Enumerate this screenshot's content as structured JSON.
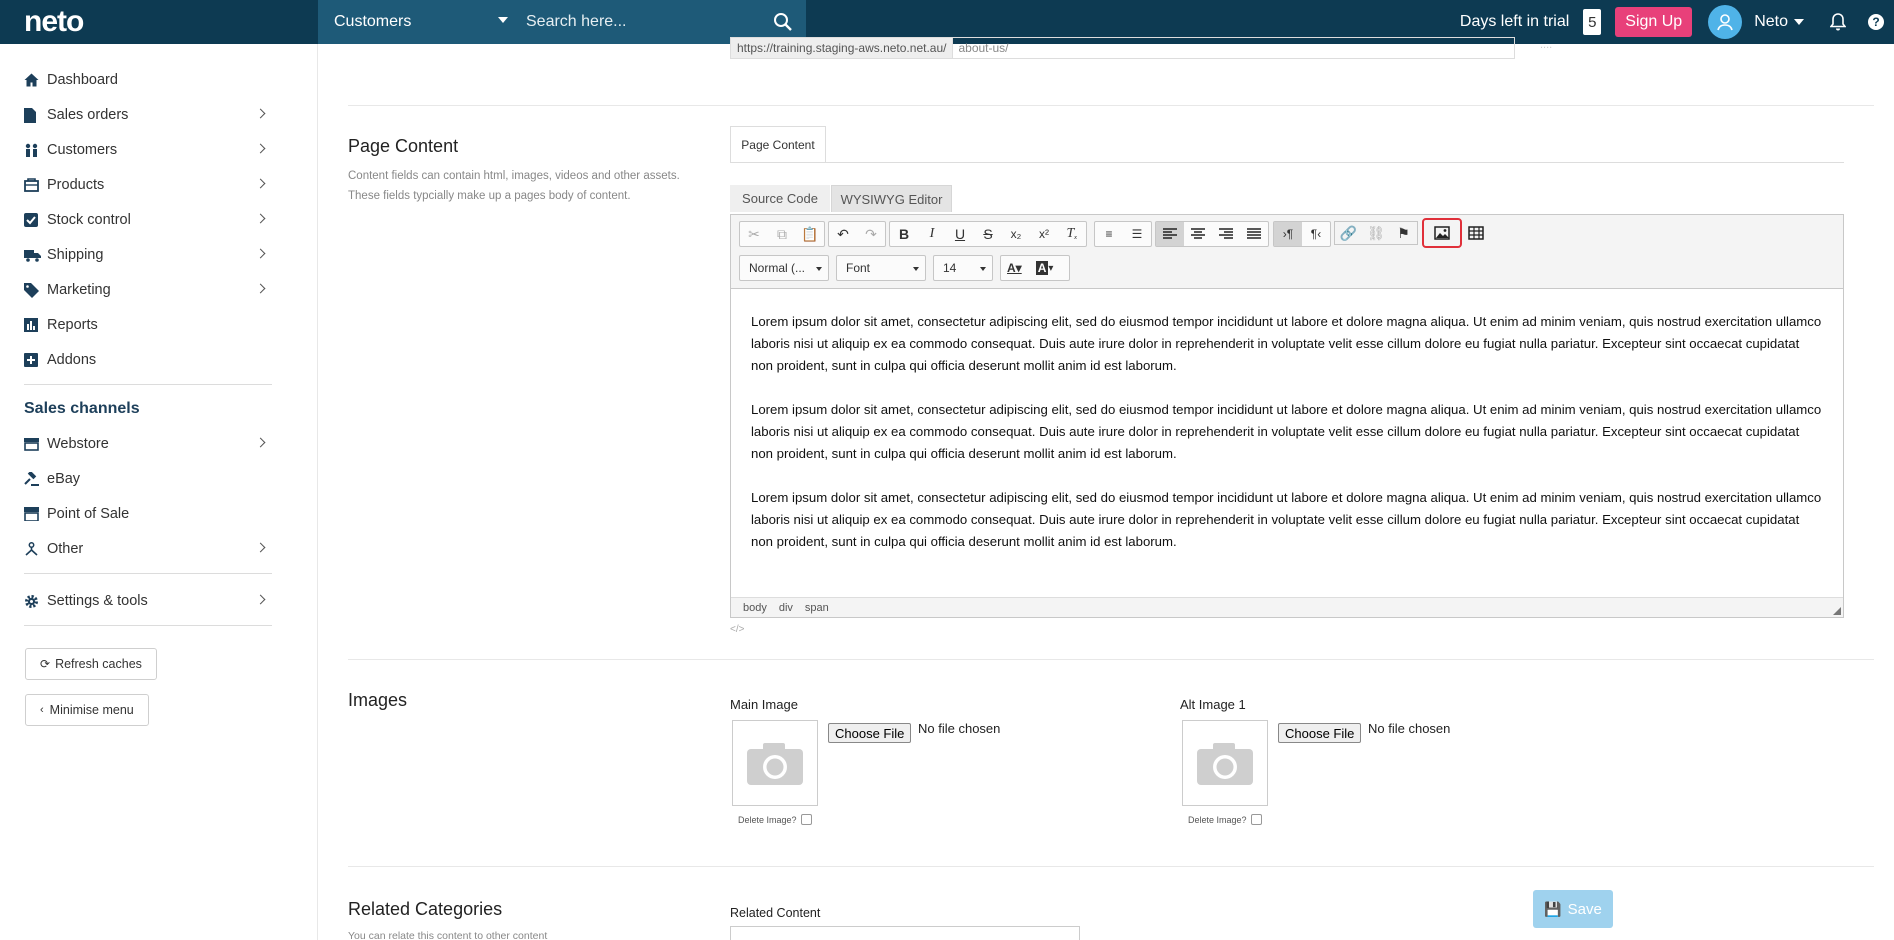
{
  "topbar": {
    "logo": "neto",
    "search_scope": "Customers",
    "search_placeholder": "Search here...",
    "trial_label": "Days left in trial",
    "trial_days": "5",
    "signup_label": "Sign Up",
    "user_name": "Neto",
    "help_label": "?"
  },
  "sidebar": {
    "items": [
      {
        "label": "Dashboard",
        "icon": "home-icon"
      },
      {
        "label": "Sales orders",
        "icon": "file-icon"
      },
      {
        "label": "Customers",
        "icon": "users-icon"
      },
      {
        "label": "Products",
        "icon": "box-icon"
      },
      {
        "label": "Stock control",
        "icon": "checkbox-icon"
      },
      {
        "label": "Shipping",
        "icon": "truck-icon"
      },
      {
        "label": "Marketing",
        "icon": "tag-icon"
      },
      {
        "label": "Reports",
        "icon": "bar-chart-icon"
      },
      {
        "label": "Addons",
        "icon": "plus-square-icon"
      }
    ],
    "sales_channels_heading": "Sales channels",
    "channels": [
      {
        "label": "Webstore",
        "icon": "store-icon"
      },
      {
        "label": "eBay",
        "icon": "gavel-icon"
      },
      {
        "label": "Point of Sale",
        "icon": "register-icon"
      },
      {
        "label": "Other",
        "icon": "share-icon"
      }
    ],
    "settings_label": "Settings & tools",
    "refresh_label": "Refresh caches",
    "minimise_label": "Minimise menu"
  },
  "url": {
    "prefix": "https://training.staging-aws.neto.net.au/",
    "value": "about-us/"
  },
  "page_content": {
    "title": "Page Content",
    "description": "Content fields can contain html, images, videos and other assets. These fields typcially make up a pages body of content.",
    "tab_label": "Page Content",
    "source_tab": "Source Code",
    "wysiwyg_tab": "WYSIWYG Editor",
    "format_select": "Normal (...",
    "font_select": "Font",
    "size_select": "14",
    "paragraphs": [
      "Lorem ipsum dolor sit amet, consectetur adipiscing elit, sed do eiusmod tempor incididunt ut labore et dolore magna aliqua. Ut enim ad minim veniam, quis nostrud exercitation ullamco laboris nisi ut aliquip ex ea commodo consequat. Duis aute irure dolor in reprehenderit in voluptate velit esse cillum dolore eu fugiat nulla pariatur. Excepteur sint occaecat cupidatat non proident, sunt in culpa qui officia deserunt mollit anim id est laborum.",
      "Lorem ipsum dolor sit amet, consectetur adipiscing elit, sed do eiusmod tempor incididunt ut labore et dolore magna aliqua. Ut enim ad minim veniam, quis nostrud exercitation ullamco laboris nisi ut aliquip ex ea commodo consequat. Duis aute irure dolor in reprehenderit in voluptate velit esse cillum dolore eu fugiat nulla pariatur. Excepteur sint occaecat cupidatat non proident, sunt in culpa qui officia deserunt mollit anim id est laborum.",
      "Lorem ipsum dolor sit amet, consectetur adipiscing elit, sed do eiusmod tempor incididunt ut labore et dolore magna aliqua. Ut enim ad minim veniam, quis nostrud exercitation ullamco laboris nisi ut aliquip ex ea commodo consequat. Duis aute irure dolor in reprehenderit in voluptate velit esse cillum dolore eu fugiat nulla pariatur. Excepteur sint occaecat cupidatat non proident, sunt in culpa qui officia deserunt mollit anim id est laborum."
    ],
    "path": [
      "body",
      "div",
      "span"
    ]
  },
  "images": {
    "title": "Images",
    "main_label": "Main Image",
    "alt_label": "Alt Image 1",
    "choose_label": "Choose File",
    "no_file": "No file chosen",
    "delete_label": "Delete Image?"
  },
  "related": {
    "title": "Related Categories",
    "description": "You can relate this content to other content",
    "content_label": "Related Content"
  },
  "save_label": "Save",
  "colors": {
    "topbar": "#0d3a52",
    "search_bg": "#1e5a78",
    "signup": "#e8407a",
    "avatar": "#4fb3e8",
    "highlight": "#e0303a",
    "save": "#9fd2ee"
  }
}
